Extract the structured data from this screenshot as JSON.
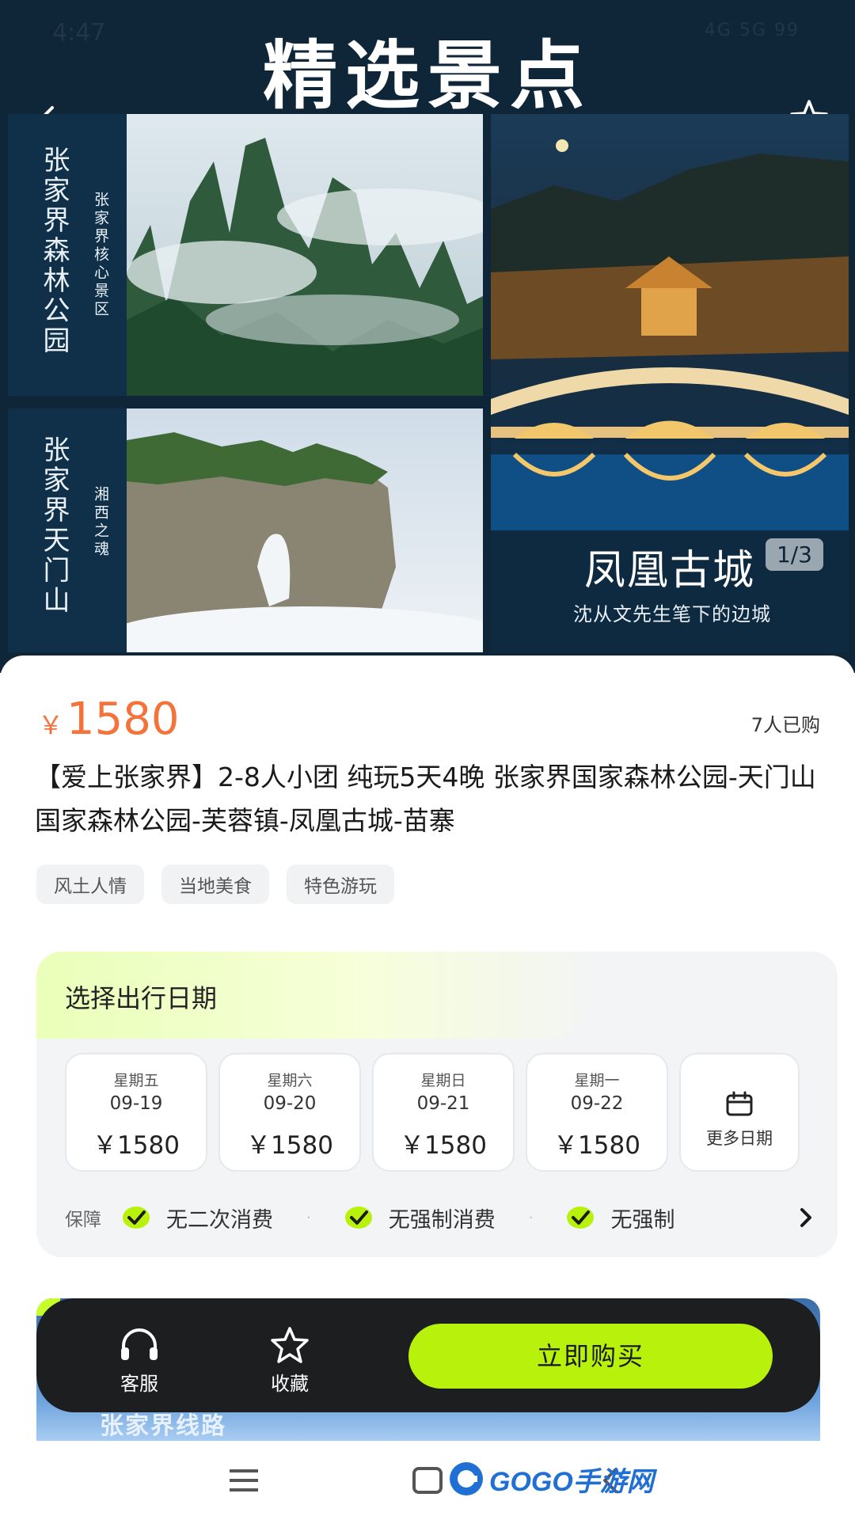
{
  "status_bar": {
    "time": "4:47",
    "indicators": "4G 5G 99"
  },
  "hero": {
    "title": "精选景点",
    "panels": [
      {
        "name": "张家界森林公园",
        "subtitle": "张家界核心景区"
      },
      {
        "name": "张家界天门山",
        "subtitle": "湘西之魂"
      },
      {
        "name": "凤凰古城",
        "subtitle": "沈从文先生笔下的边城",
        "counter": "1/3"
      }
    ]
  },
  "product": {
    "currency": "￥",
    "price": "1580",
    "sold": "7人已购",
    "title": "【爱上张家界】2-8人小团 纯玩5天4晚 张家界国家森林公园-天门山国家森林公园-芙蓉镇-凤凰古城-苗寨",
    "tags": [
      "风土人情",
      "当地美食",
      "特色游玩"
    ]
  },
  "date_selector": {
    "title": "选择出行日期",
    "dates": [
      {
        "weekday": "星期五",
        "date": "09-19",
        "price": "￥1580"
      },
      {
        "weekday": "星期六",
        "date": "09-20",
        "price": "￥1580"
      },
      {
        "weekday": "星期日",
        "date": "09-21",
        "price": "￥1580"
      },
      {
        "weekday": "星期一",
        "date": "09-22",
        "price": "￥1580"
      }
    ],
    "more_label": "更多日期",
    "guarantee_label": "保障",
    "guarantees": [
      "无二次消费",
      "无强制消费",
      "无强制"
    ]
  },
  "promo": {
    "text": "张家界线路"
  },
  "action_bar": {
    "service_label": "客服",
    "favorite_label": "收藏",
    "buy_label": "立即购买"
  },
  "watermark": {
    "text": "GOGO手游网"
  },
  "colors": {
    "price": "#f3733a",
    "accent": "#b8f20c",
    "hero_bg": "#0f2538",
    "bar_bg": "#1c1e20"
  }
}
